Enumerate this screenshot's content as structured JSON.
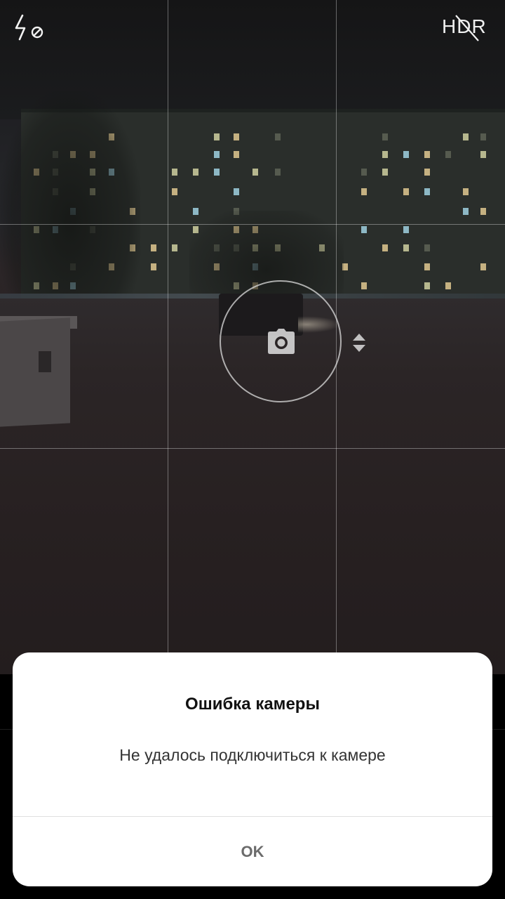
{
  "camera": {
    "flash_mode": "flash-off",
    "hdr_label": "HDR",
    "hdr_state": "off",
    "grid": "3x3"
  },
  "dialog": {
    "title": "Ошибка камеры",
    "message": "Не удалось подключиться к камере",
    "ok_label": "OK"
  }
}
